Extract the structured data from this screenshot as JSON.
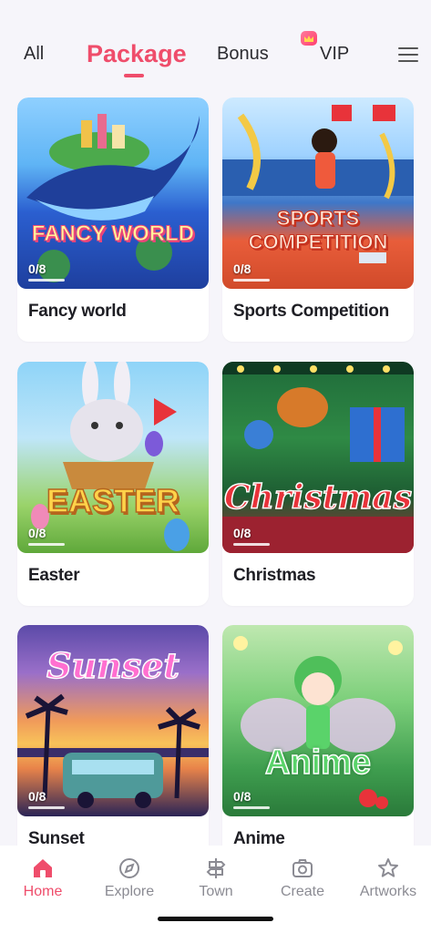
{
  "tabs": {
    "all": "All",
    "package": "Package",
    "bonus": "Bonus",
    "vip": "VIP"
  },
  "cards": [
    {
      "name": "Fancy world",
      "progress": "0/8",
      "art_title": "FANCY WORLD"
    },
    {
      "name": "Sports Competition",
      "progress": "0/8",
      "art_title_line1": "SPORTS",
      "art_title_line2": "COMPETITION"
    },
    {
      "name": "Easter",
      "progress": "0/8",
      "art_title": "EASTER"
    },
    {
      "name": "Christmas",
      "progress": "0/8",
      "art_title": "Christmas"
    },
    {
      "name": "Sunset",
      "progress": "0/8",
      "art_title": "Sunset"
    },
    {
      "name": "Anime",
      "progress": "0/8",
      "art_title": "Anime"
    }
  ],
  "nav": {
    "home": "Home",
    "explore": "Explore",
    "town": "Town",
    "create": "Create",
    "artworks": "Artworks"
  },
  "colors": {
    "accent": "#ef4d6b",
    "inactive": "#8b8b93",
    "background": "#f6f5fa"
  },
  "icons": [
    "home-icon",
    "explore-icon",
    "town-icon",
    "create-icon",
    "artworks-icon",
    "crown-icon",
    "menu-icon"
  ]
}
